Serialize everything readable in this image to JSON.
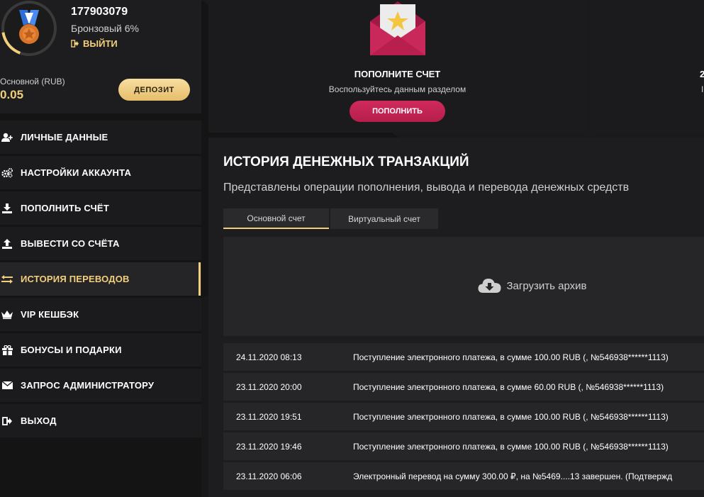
{
  "profile": {
    "user_id": "177903079",
    "level": "Бронзовый 6%",
    "logout_label": "ВЫЙТИ",
    "account_label": "Основной (RUB)",
    "balance": "0.05",
    "deposit_label": "ДЕПОЗИТ",
    "level_progress": 0.17
  },
  "menu": {
    "items": [
      {
        "label": "ЛИЧНЫЕ ДАННЫЕ",
        "icon": "user-add-icon"
      },
      {
        "label": "НАСТРОЙКИ АККАУНТА",
        "icon": "gears-icon"
      },
      {
        "label": "ПОПОЛНИТЬ СЧЁТ",
        "icon": "download-icon"
      },
      {
        "label": "ВЫВЕСТИ СО СЧЁТА",
        "icon": "upload-icon"
      },
      {
        "label": "ИСТОРИЯ ПЕРЕВОДОВ",
        "icon": "transfer-arrows-icon",
        "active": true
      },
      {
        "label": "VIP КЕШБЭК",
        "icon": "crown-icon"
      },
      {
        "label": "БОНУСЫ И ПОДАРКИ",
        "icon": "gift-icon"
      },
      {
        "label": "ЗАПРОС АДМИНИСТРАТОРУ",
        "icon": "envelope-icon"
      },
      {
        "label": "ВЫХОД",
        "icon": "exit-icon"
      }
    ]
  },
  "replenish_card": {
    "title": "ПОПОЛНИТЕ СЧЕТ",
    "subtitle": "Воспользуйтесь данным разделом",
    "button_label": "ПОПОЛНИТЬ"
  },
  "right_card": {
    "title_fragment": "2",
    "subtitle_fragment": "I"
  },
  "history": {
    "title": "ИСТОРИЯ ДЕНЕЖНЫХ ТРАНЗАКЦИЙ",
    "subtitle": "Представлены операции пополнения, вывода и перевода денежных средств",
    "tabs": [
      {
        "label": "Основной счет",
        "active": true
      },
      {
        "label": "Виртуальный счет",
        "active": false
      }
    ],
    "archive_label": "Загрузить архив",
    "transactions": [
      {
        "date": "24.11.2020 08:13",
        "description": "Поступление электронного платежа, в сумме 100.00 RUB (, №546938******1113)"
      },
      {
        "date": "23.11.2020 20:00",
        "description": "Поступление электронного платежа, в сумме 60.00 RUB (, №546938******1113)"
      },
      {
        "date": "23.11.2020 19:51",
        "description": "Поступление электронного платежа, в сумме 100.00 RUB (, №546938******1113)"
      },
      {
        "date": "23.11.2020 19:46",
        "description": "Поступление электронного платежа, в сумме 100.00 RUB (, №546938******1113)"
      },
      {
        "date": "23.11.2020 06:06",
        "description": "Электронный перевод на сумму 300.00 ₽, на №5469....13 завершен. (Подтвержд"
      }
    ]
  },
  "colors": {
    "accent_gold": "#f2cf7b",
    "accent_pink": "#c7245a",
    "panel_bg": "#1d1d1f"
  }
}
